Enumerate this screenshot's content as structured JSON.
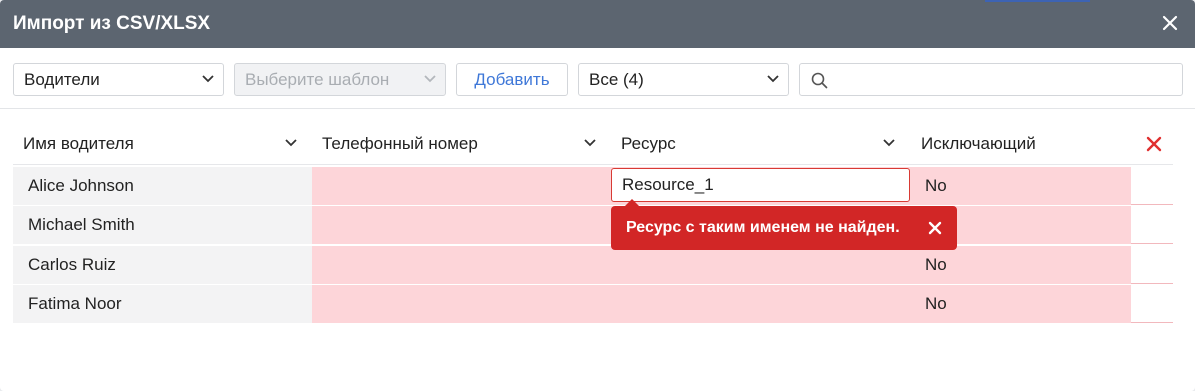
{
  "dialog": {
    "title": "Импорт из CSV/XLSX",
    "close_icon": "close-icon"
  },
  "toolbar": {
    "entity_select": "Водители",
    "template_select_placeholder": "Выберите шаблон",
    "add_button": "Добавить",
    "filter_select": "Все (4)",
    "search_value": "",
    "search_icon": "search-icon"
  },
  "table": {
    "columns": [
      "Имя водителя",
      "Телефонный номер",
      "Ресурс",
      "Исключающий"
    ],
    "remove_icon": "close-icon",
    "rows": [
      {
        "name": "Alice Johnson",
        "phone": "",
        "resource": "Resource_1",
        "exclusive": "No"
      },
      {
        "name": "Michael Smith",
        "phone": "",
        "resource": "",
        "exclusive": ""
      },
      {
        "name": "Carlos Ruiz",
        "phone": "",
        "resource": "",
        "exclusive": "No"
      },
      {
        "name": "Fatima Noor",
        "phone": "",
        "resource": "",
        "exclusive": "No"
      }
    ]
  },
  "error_tooltip": {
    "message": "Ресурс с таким именем не найден."
  },
  "colors": {
    "titlebar": "#5c6570",
    "error_row": "#fdd5d9",
    "error_tooltip": "#d22626",
    "link_blue": "#3f78d8"
  }
}
